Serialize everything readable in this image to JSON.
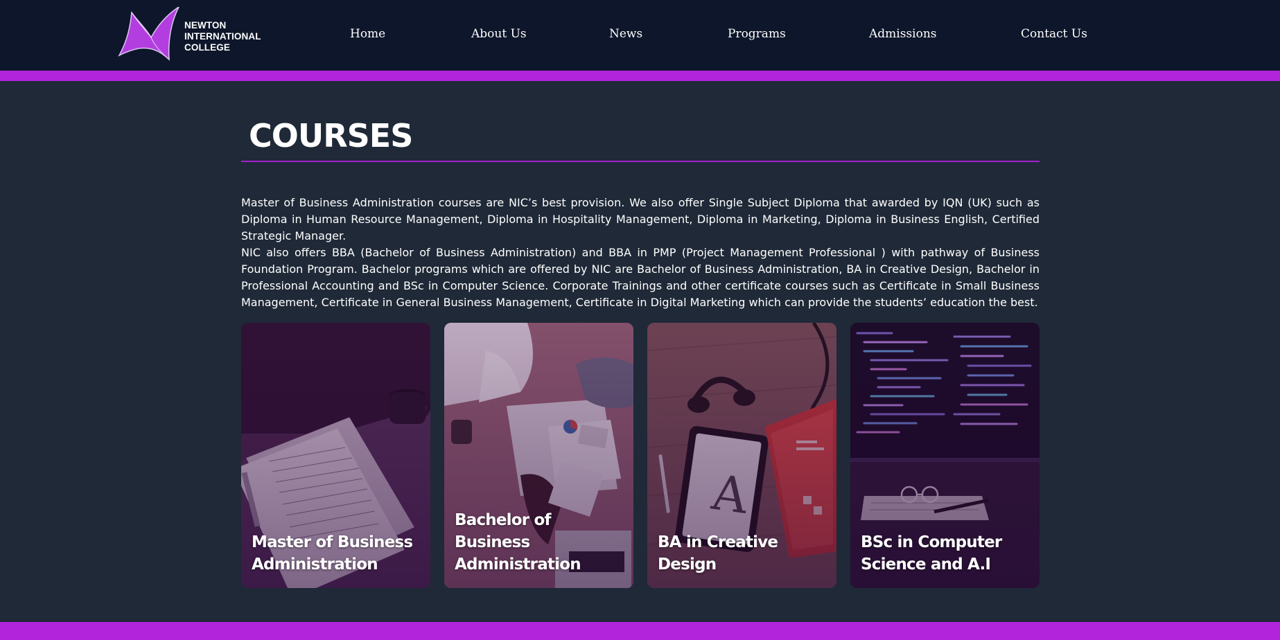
{
  "brand": {
    "name_lines": [
      "NEWTON",
      "INTERNATIONAL",
      "COLLEGE"
    ],
    "logo_icon": "nic-swoosh-logo",
    "accent_color": "#b224dc"
  },
  "nav": {
    "items": [
      {
        "label": "Home"
      },
      {
        "label": "About Us"
      },
      {
        "label": "News"
      },
      {
        "label": "Programs"
      },
      {
        "label": "Admissions"
      },
      {
        "label": "Contact Us"
      }
    ]
  },
  "page": {
    "title": "COURSES",
    "paragraphs": [
      "Master of Business Administration courses are NIC’s best provision. We also offer Single Subject Diploma that awarded by IQN (UK) such as Diploma in Human Resource Management, Diploma in Hospitality Management, Diploma in Marketing, Diploma in Business English, Certified Strategic Manager.",
      "NIC also offers BBA (Bachelor of Business Administration) and BBA in PMP (Project Management Professional ) with pathway of Business Foundation Program. Bachelor programs which are offered by NIC are Bachelor of Business Administration, BA in Creative Design, Bachelor in Professional Accounting and BSc in Computer Science. Corporate Trainings and other certificate courses such as Certificate in Small Business Management, Certificate in General Business Management, Certificate in Digital Marketing which can provide the students’ education the best."
    ]
  },
  "courses": [
    {
      "line1": "Master of Business",
      "line2": "Administration",
      "image": "tax-forms-and-coffee-photo"
    },
    {
      "line1": "Bachelor of Business",
      "line2": "Administration",
      "image": "business-meeting-charts-photo"
    },
    {
      "line1": "BA in Creative Design",
      "line2": "",
      "image": "tablet-headphones-notebook-photo"
    },
    {
      "line1": "BSc in Computer",
      "line2": "Science and A.I",
      "image": "code-monitor-glasses-photo"
    }
  ]
}
